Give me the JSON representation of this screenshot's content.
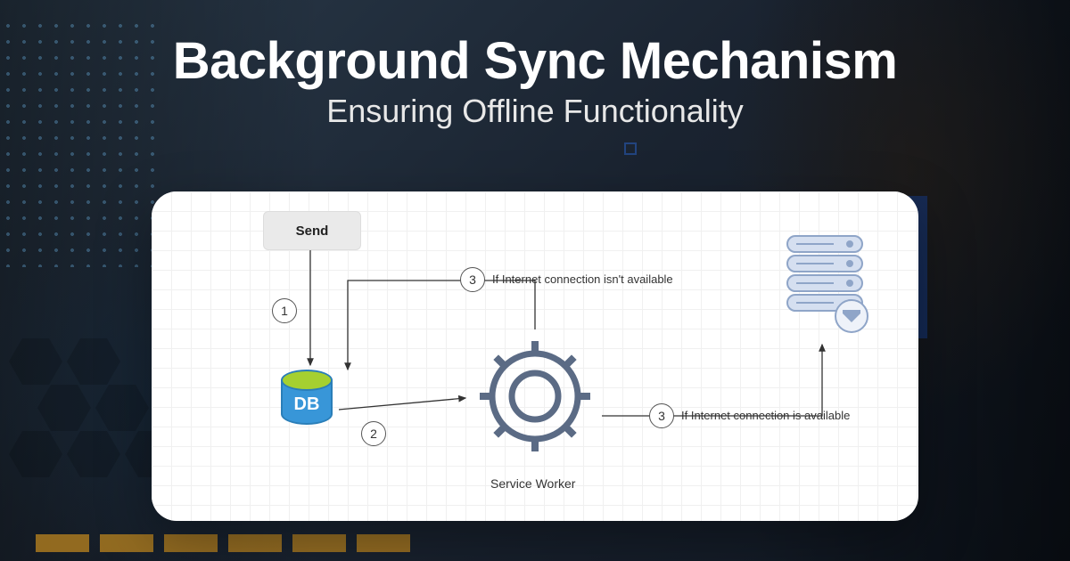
{
  "header": {
    "title": "Background Sync Mechanism",
    "subtitle": "Ensuring Offline Functionality"
  },
  "diagram": {
    "send_button": "Send",
    "db_label": "DB",
    "service_worker_label": "Service Worker",
    "steps": {
      "step1": "1",
      "step2": "2",
      "step3_top": "3",
      "step3_bottom": "3"
    },
    "labels": {
      "no_internet": "If Internet connection isn't available",
      "has_internet": "If Internet connection is available"
    }
  }
}
